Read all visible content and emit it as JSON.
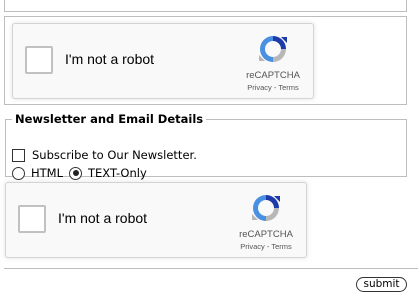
{
  "recaptcha_1": {
    "label": "I'm not a robot",
    "brand": "reCAPTCHA",
    "privacy": "Privacy",
    "separator": " - ",
    "terms": "Terms"
  },
  "newsletter": {
    "legend": "Newsletter and Email Details",
    "subscribe_label": "Subscribe to Our Newsletter.",
    "subscribe_checked": false,
    "format_options": [
      "HTML",
      "TEXT-Only"
    ],
    "format_selected": "TEXT-Only"
  },
  "recaptcha_2": {
    "label": "I'm not a robot",
    "brand": "reCAPTCHA",
    "privacy": "Privacy",
    "separator": " - ",
    "terms": "Terms"
  },
  "form": {
    "submit_label": "submit"
  },
  "colors": {
    "recaptcha_blue": "#4a90e2",
    "recaptcha_dark_blue": "#1c3aa9",
    "recaptcha_grey": "#b8b8b8",
    "border": "#bdbdbd"
  }
}
